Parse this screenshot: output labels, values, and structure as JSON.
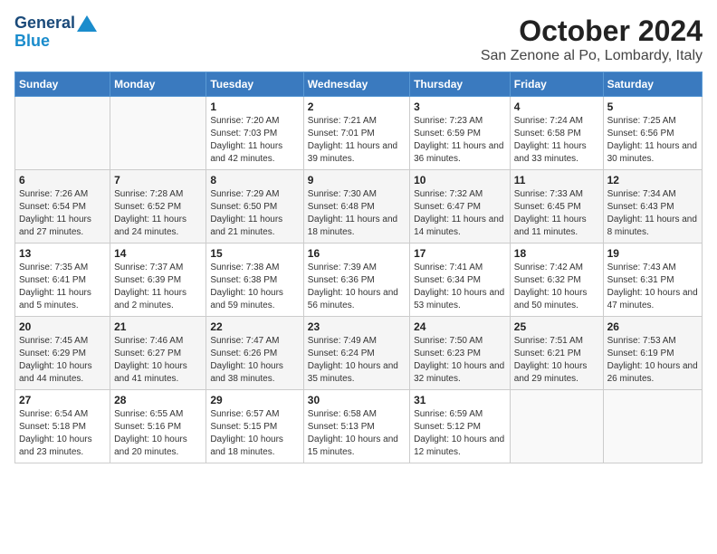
{
  "logo": {
    "line1": "General",
    "line2": "Blue"
  },
  "title": "October 2024",
  "subtitle": "San Zenone al Po, Lombardy, Italy",
  "headers": [
    "Sunday",
    "Monday",
    "Tuesday",
    "Wednesday",
    "Thursday",
    "Friday",
    "Saturday"
  ],
  "weeks": [
    [
      {
        "day": "",
        "info": ""
      },
      {
        "day": "",
        "info": ""
      },
      {
        "day": "1",
        "info": "Sunrise: 7:20 AM\nSunset: 7:03 PM\nDaylight: 11 hours and 42 minutes."
      },
      {
        "day": "2",
        "info": "Sunrise: 7:21 AM\nSunset: 7:01 PM\nDaylight: 11 hours and 39 minutes."
      },
      {
        "day": "3",
        "info": "Sunrise: 7:23 AM\nSunset: 6:59 PM\nDaylight: 11 hours and 36 minutes."
      },
      {
        "day": "4",
        "info": "Sunrise: 7:24 AM\nSunset: 6:58 PM\nDaylight: 11 hours and 33 minutes."
      },
      {
        "day": "5",
        "info": "Sunrise: 7:25 AM\nSunset: 6:56 PM\nDaylight: 11 hours and 30 minutes."
      }
    ],
    [
      {
        "day": "6",
        "info": "Sunrise: 7:26 AM\nSunset: 6:54 PM\nDaylight: 11 hours and 27 minutes."
      },
      {
        "day": "7",
        "info": "Sunrise: 7:28 AM\nSunset: 6:52 PM\nDaylight: 11 hours and 24 minutes."
      },
      {
        "day": "8",
        "info": "Sunrise: 7:29 AM\nSunset: 6:50 PM\nDaylight: 11 hours and 21 minutes."
      },
      {
        "day": "9",
        "info": "Sunrise: 7:30 AM\nSunset: 6:48 PM\nDaylight: 11 hours and 18 minutes."
      },
      {
        "day": "10",
        "info": "Sunrise: 7:32 AM\nSunset: 6:47 PM\nDaylight: 11 hours and 14 minutes."
      },
      {
        "day": "11",
        "info": "Sunrise: 7:33 AM\nSunset: 6:45 PM\nDaylight: 11 hours and 11 minutes."
      },
      {
        "day": "12",
        "info": "Sunrise: 7:34 AM\nSunset: 6:43 PM\nDaylight: 11 hours and 8 minutes."
      }
    ],
    [
      {
        "day": "13",
        "info": "Sunrise: 7:35 AM\nSunset: 6:41 PM\nDaylight: 11 hours and 5 minutes."
      },
      {
        "day": "14",
        "info": "Sunrise: 7:37 AM\nSunset: 6:39 PM\nDaylight: 11 hours and 2 minutes."
      },
      {
        "day": "15",
        "info": "Sunrise: 7:38 AM\nSunset: 6:38 PM\nDaylight: 10 hours and 59 minutes."
      },
      {
        "day": "16",
        "info": "Sunrise: 7:39 AM\nSunset: 6:36 PM\nDaylight: 10 hours and 56 minutes."
      },
      {
        "day": "17",
        "info": "Sunrise: 7:41 AM\nSunset: 6:34 PM\nDaylight: 10 hours and 53 minutes."
      },
      {
        "day": "18",
        "info": "Sunrise: 7:42 AM\nSunset: 6:32 PM\nDaylight: 10 hours and 50 minutes."
      },
      {
        "day": "19",
        "info": "Sunrise: 7:43 AM\nSunset: 6:31 PM\nDaylight: 10 hours and 47 minutes."
      }
    ],
    [
      {
        "day": "20",
        "info": "Sunrise: 7:45 AM\nSunset: 6:29 PM\nDaylight: 10 hours and 44 minutes."
      },
      {
        "day": "21",
        "info": "Sunrise: 7:46 AM\nSunset: 6:27 PM\nDaylight: 10 hours and 41 minutes."
      },
      {
        "day": "22",
        "info": "Sunrise: 7:47 AM\nSunset: 6:26 PM\nDaylight: 10 hours and 38 minutes."
      },
      {
        "day": "23",
        "info": "Sunrise: 7:49 AM\nSunset: 6:24 PM\nDaylight: 10 hours and 35 minutes."
      },
      {
        "day": "24",
        "info": "Sunrise: 7:50 AM\nSunset: 6:23 PM\nDaylight: 10 hours and 32 minutes."
      },
      {
        "day": "25",
        "info": "Sunrise: 7:51 AM\nSunset: 6:21 PM\nDaylight: 10 hours and 29 minutes."
      },
      {
        "day": "26",
        "info": "Sunrise: 7:53 AM\nSunset: 6:19 PM\nDaylight: 10 hours and 26 minutes."
      }
    ],
    [
      {
        "day": "27",
        "info": "Sunrise: 6:54 AM\nSunset: 5:18 PM\nDaylight: 10 hours and 23 minutes."
      },
      {
        "day": "28",
        "info": "Sunrise: 6:55 AM\nSunset: 5:16 PM\nDaylight: 10 hours and 20 minutes."
      },
      {
        "day": "29",
        "info": "Sunrise: 6:57 AM\nSunset: 5:15 PM\nDaylight: 10 hours and 18 minutes."
      },
      {
        "day": "30",
        "info": "Sunrise: 6:58 AM\nSunset: 5:13 PM\nDaylight: 10 hours and 15 minutes."
      },
      {
        "day": "31",
        "info": "Sunrise: 6:59 AM\nSunset: 5:12 PM\nDaylight: 10 hours and 12 minutes."
      },
      {
        "day": "",
        "info": ""
      },
      {
        "day": "",
        "info": ""
      }
    ]
  ]
}
